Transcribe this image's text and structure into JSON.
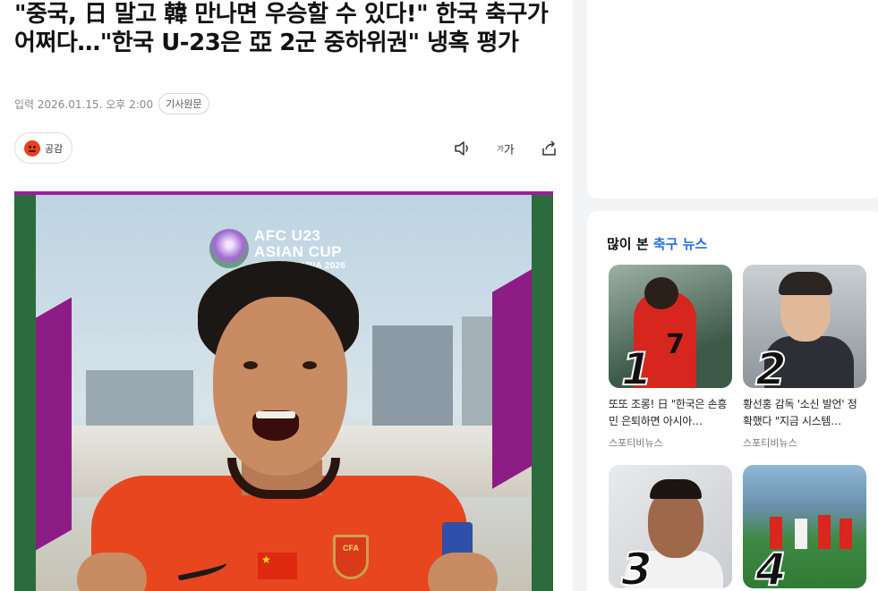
{
  "article": {
    "headline": "\"중국, 日 말고 韓 만나면 우승할 수 있다!\" 한국 축구가 어쩌다…\"한국 U-23은 亞 2군 중하위권\" 냉혹 평가",
    "published": "입력 2026.01.15. 오후 2:00",
    "original_button": "기사원문",
    "reaction_label": "공감",
    "tools": {
      "audio_icon": "speaker-icon",
      "font_small": "가",
      "font_large": "가",
      "share_icon": "share-icon"
    },
    "hero": {
      "logo_line1": "AFC U23",
      "logo_line2": "ASIAN CUP",
      "logo_line3": "SAUDI ARABIA 2026",
      "crest_text": "CFA"
    }
  },
  "sidebar": {
    "title_prefix": "많이 본",
    "title_accent": "축구 뉴스",
    "accent_color": "#1f6df2",
    "cards": [
      {
        "rank": "1",
        "title": "또또 조롱! 日 \"한국은 손흥민 은퇴하면 아시아…",
        "source": "스포티비뉴스"
      },
      {
        "rank": "2",
        "title": "황선홍 감독 '소신 발언' 정확했다 \"지금 시스템…",
        "source": "스포티비뉴스"
      },
      {
        "rank": "3",
        "title": "",
        "source": ""
      },
      {
        "rank": "4",
        "title": "",
        "source": ""
      }
    ]
  }
}
